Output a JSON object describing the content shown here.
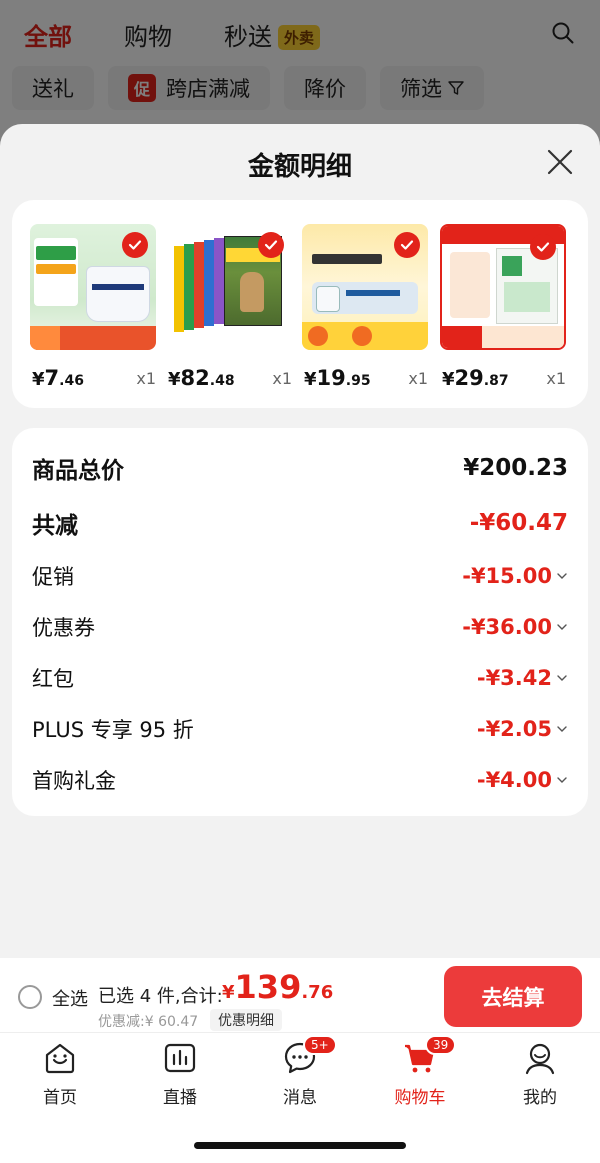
{
  "background": {
    "tabs": [
      "全部",
      "购物",
      "秒送"
    ],
    "takeaway_badge": "外卖",
    "filters": [
      "送礼",
      "跨店满减",
      "降价",
      "筛选"
    ],
    "promo_tag": "促"
  },
  "sheet": {
    "title": "金额明细",
    "products": [
      {
        "cur": "¥",
        "int": "7",
        "dec": ".46",
        "qty": "x1"
      },
      {
        "cur": "¥",
        "int": "82",
        "dec": ".48",
        "qty": "x1"
      },
      {
        "cur": "¥",
        "int": "19",
        "dec": ".95",
        "qty": "x1"
      },
      {
        "cur": "¥",
        "int": "29",
        "dec": ".87",
        "qty": "x1"
      }
    ],
    "summary": {
      "total_label": "商品总价",
      "total_value": "¥200.23",
      "reduce_label": "共减",
      "reduce_value": "-¥60.47",
      "items": [
        {
          "label": "促销",
          "value": "-¥15.00"
        },
        {
          "label": "优惠券",
          "value": "-¥36.00"
        },
        {
          "label": "红包",
          "value": "-¥3.42"
        },
        {
          "label": "PLUS 专享 95 折",
          "value": "-¥2.05"
        },
        {
          "label": "首购礼金",
          "value": "-¥4.00"
        }
      ]
    }
  },
  "checkout": {
    "select_all": "全选",
    "selected_text": "已选 4 件,合计:",
    "total_cur": "¥",
    "total_int": "139",
    "total_dec": ".76",
    "discount_text": "优惠减:¥ 60.47",
    "detail_link": "优惠明细",
    "pay_button": "去结算"
  },
  "tabbar": [
    {
      "label": "首页",
      "icon": "home-icon"
    },
    {
      "label": "直播",
      "icon": "live-icon"
    },
    {
      "label": "消息",
      "icon": "message-icon",
      "badge": "5+"
    },
    {
      "label": "购物车",
      "icon": "cart-icon",
      "badge": "39",
      "active": true
    },
    {
      "label": "我的",
      "icon": "profile-icon"
    }
  ],
  "colors": {
    "accent": "#e2231a",
    "button": "#ec3b3b"
  }
}
